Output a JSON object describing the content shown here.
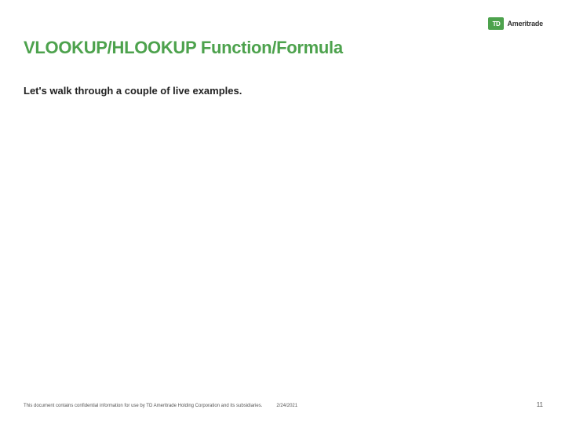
{
  "brand": {
    "name": "Ameritrade",
    "mark_label": "TD"
  },
  "slide": {
    "title": "VLOOKUP/HLOOKUP Function/Formula",
    "body": "Let's walk through a couple of live examples."
  },
  "footer": {
    "disclaimer": "This document contains confidential information for use by TD Ameritrade Holding Corporation and its subsidiaries.",
    "date": "2/24/2021",
    "page_number": "11"
  }
}
